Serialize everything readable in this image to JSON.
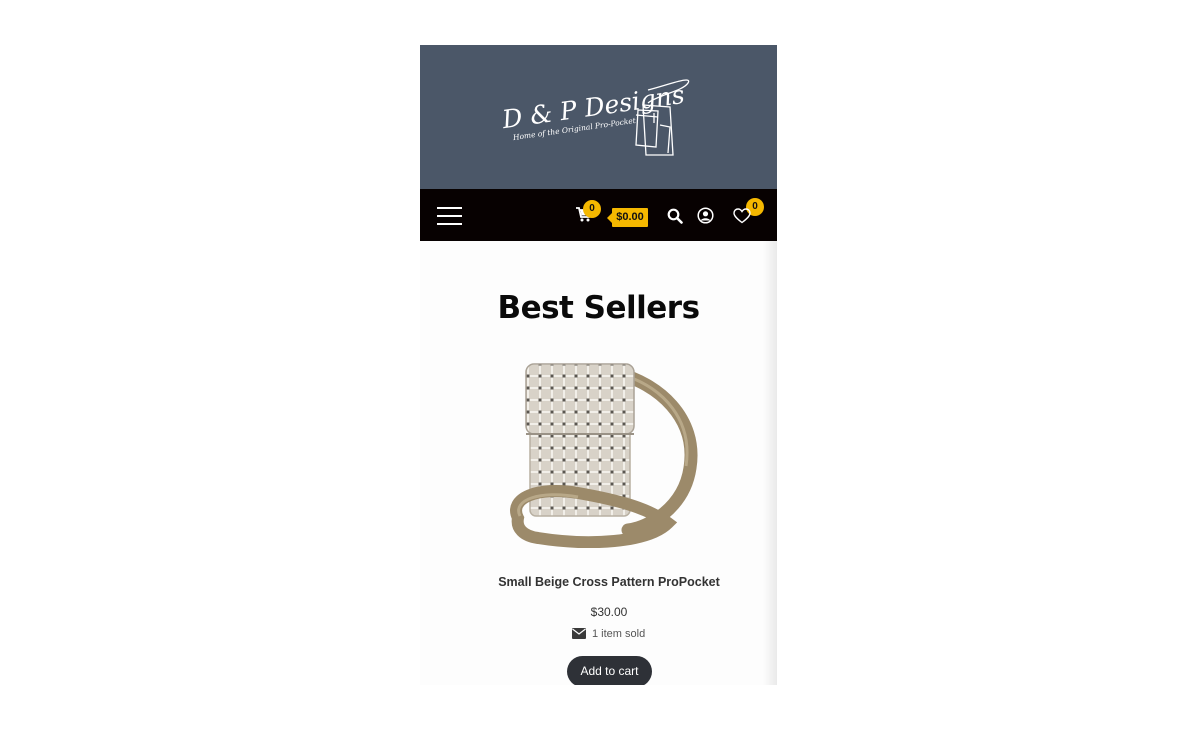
{
  "header": {
    "logo_title": "D & P Designs",
    "logo_tagline": "Home of the Original Pro-Pocket"
  },
  "nav": {
    "cart_count": "0",
    "cart_total": "$0.00",
    "wishlist_count": "0"
  },
  "section": {
    "title": "Best Sellers"
  },
  "product": {
    "name": "Small Beige Cross Pattern ProPocket",
    "price": "$30.00",
    "sold": "1 item sold",
    "add_to_cart_label": "Add to cart"
  },
  "colors": {
    "banner": "#4b5768",
    "nav": "#070101",
    "accent": "#f5b800",
    "button": "#2e3137"
  }
}
